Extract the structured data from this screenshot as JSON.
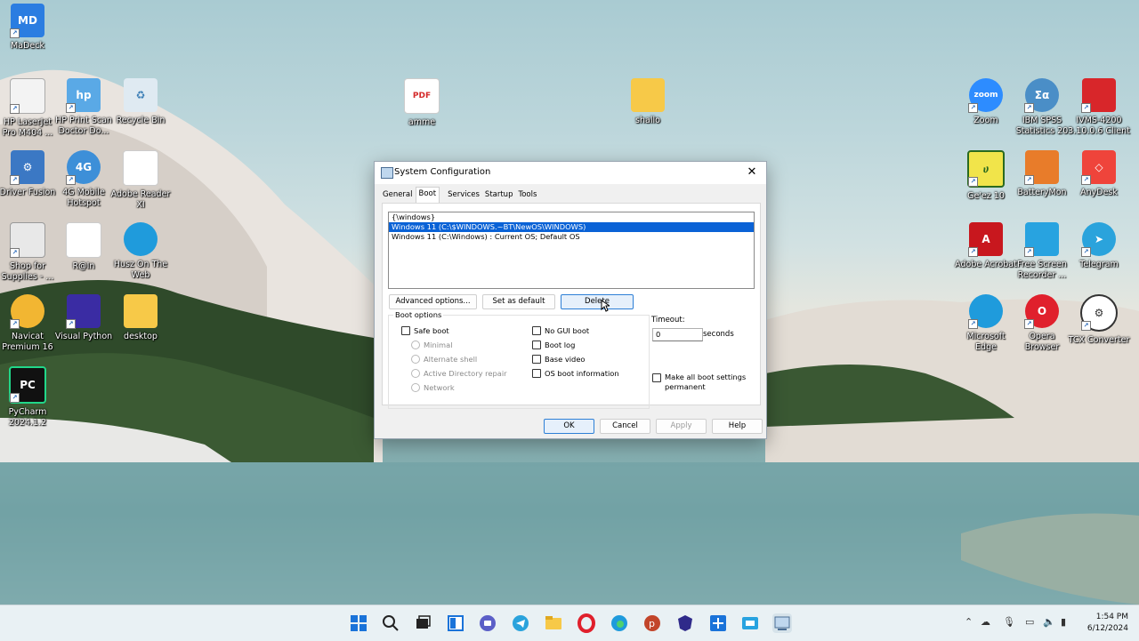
{
  "desktop": {
    "icons": [
      {
        "label": "MaDeck"
      },
      {
        "label": "HP LaserJet Pro M404 ..."
      },
      {
        "label": "HP Print Scan Doctor Do..."
      },
      {
        "label": "Recycle Bin"
      },
      {
        "label": "amme",
        "badge": "PDF"
      },
      {
        "label": "shallo"
      },
      {
        "label": "Driver Fusion"
      },
      {
        "label": "4G Mobile Hotspot",
        "badge": "4G"
      },
      {
        "label": "Adobe Reader XI"
      },
      {
        "label": "Shop for Supplies - ..."
      },
      {
        "label": "R@In"
      },
      {
        "label": "Husz On The Web"
      },
      {
        "label": "Navicat Premium 16"
      },
      {
        "label": "Visual Python"
      },
      {
        "label": "desktop"
      },
      {
        "label": "PyCharm 2024.1.2",
        "badge": "PC"
      },
      {
        "label": "Zoom",
        "badge": "zoom"
      },
      {
        "label": "IBM SPSS Statistics 20"
      },
      {
        "label": "IVMS-4200 3.10.0.6 Client"
      },
      {
        "label": "Ge'ez 10"
      },
      {
        "label": "BatteryMon"
      },
      {
        "label": "AnyDesk"
      },
      {
        "label": "Adobe Acrobat"
      },
      {
        "label": "Free Screen Recorder ..."
      },
      {
        "label": "Telegram"
      },
      {
        "label": "Microsoft Edge"
      },
      {
        "label": "Opera Browser"
      },
      {
        "label": "TCX Converter"
      }
    ]
  },
  "dialog": {
    "title": "System Configuration",
    "close_glyph": "✕",
    "tabs": [
      "General",
      "Boot",
      "Services",
      "Startup",
      "Tools"
    ],
    "active_tab": "Boot",
    "os_list": [
      "{\\windows}",
      "Windows 11 (C:\\$WINDOWS.~BT\\NewOS\\WINDOWS)",
      "Windows 11 (C:\\Windows) : Current OS; Default OS"
    ],
    "selected_os_index": 1,
    "buttons": {
      "advanced": "Advanced options...",
      "set_default": "Set as default",
      "delete": "Delete"
    },
    "boot_options": {
      "title": "Boot options",
      "safe_boot": "Safe boot",
      "minimal": "Minimal",
      "alternate_shell": "Alternate shell",
      "ad_repair": "Active Directory repair",
      "network": "Network",
      "no_gui": "No GUI boot",
      "boot_log": "Boot log",
      "base_video": "Base video",
      "os_boot_info": "OS boot information"
    },
    "timeout": {
      "label": "Timeout:",
      "value": "0",
      "unit": "seconds"
    },
    "make_permanent": "Make all boot settings permanent",
    "footer": {
      "ok": "OK",
      "cancel": "Cancel",
      "apply": "Apply",
      "help": "Help"
    }
  },
  "taskbar": {
    "apps": [
      "start-icon",
      "search-icon",
      "task-view-icon",
      "widgets-icon",
      "chat-icon",
      "telegram-icon",
      "file-explorer-icon",
      "opera-icon",
      "edge-icon",
      "pdf-reader-icon",
      "app-shield-icon",
      "plus-app-icon",
      "screen-recorder-icon",
      "system-configuration-icon"
    ],
    "time": "1:54 PM",
    "date": "6/12/2024"
  }
}
